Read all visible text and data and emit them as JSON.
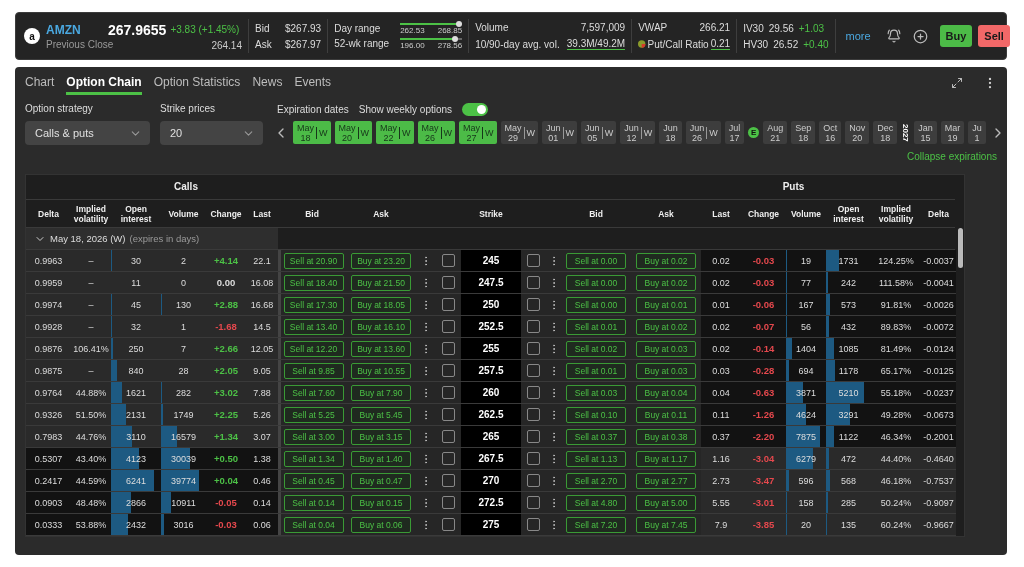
{
  "quote": {
    "logo": "a",
    "symbol": "AMZN",
    "subtitle": "Previous Close",
    "price": "267.9655",
    "change": "+3.83 (+1.45%)",
    "color": "#4cc146",
    "previous_close": "264.14",
    "bid_label": "Bid",
    "bid": "$267.93",
    "ask_label": "Ask",
    "ask": "$267.97",
    "ranges": [
      {
        "label": "Day range",
        "low": "262.53",
        "high": "268.85",
        "level": 0.95
      },
      {
        "label": "52-wk range",
        "low": "196.00",
        "high": "278.56",
        "level": 0.88
      }
    ],
    "volume_label": "Volume",
    "volume": "7,597,009",
    "avg_label": "10/90-day avg. vol.",
    "avg": "39.3M/49.2M",
    "vwap_label": "VWAP",
    "vwap": "266.21",
    "pc_label": "Put/Call Ratio",
    "pc": "0.21",
    "vols": [
      {
        "label": "IV30",
        "value": "29.56",
        "change": "+1.03",
        "color": "#4cc146"
      },
      {
        "label": "HV30",
        "value": "26.52",
        "change": "+0.40",
        "color": "#4cc146"
      }
    ],
    "more": "more",
    "buy": "Buy",
    "sell": "Sell"
  },
  "tabs": [
    {
      "label": "Chart",
      "selected": false
    },
    {
      "label": "Option Chain",
      "selected": true
    },
    {
      "label": "Option Statistics",
      "selected": false
    },
    {
      "label": "News",
      "selected": false
    },
    {
      "label": "Events",
      "selected": false
    }
  ],
  "controls": {
    "strategy": {
      "label": "Option strategy",
      "value": "Calls & puts"
    },
    "strikes": {
      "label": "Strike prices",
      "value": "20"
    },
    "expiration_label": "Expiration dates",
    "weekly": {
      "label": "Show weekly options",
      "on": true
    },
    "collapse": "Collapse expirations"
  },
  "expirations": [
    {
      "kind": "date",
      "month": "May",
      "day": "18",
      "tag": "W",
      "selected": true
    },
    {
      "kind": "date",
      "month": "May",
      "day": "20",
      "tag": "W",
      "selected": true
    },
    {
      "kind": "date",
      "month": "May",
      "day": "22",
      "tag": "W",
      "selected": true
    },
    {
      "kind": "date",
      "month": "May",
      "day": "26",
      "tag": "W",
      "selected": true
    },
    {
      "kind": "date",
      "month": "May",
      "day": "27",
      "tag": "W",
      "selected": true
    },
    {
      "kind": "date",
      "month": "May",
      "day": "29",
      "tag": "W",
      "selected": false
    },
    {
      "kind": "date",
      "month": "Jun",
      "day": "01",
      "tag": "W",
      "selected": false
    },
    {
      "kind": "date",
      "month": "Jun",
      "day": "05",
      "tag": "W",
      "selected": false
    },
    {
      "kind": "date",
      "month": "Jun",
      "day": "12",
      "tag": "W",
      "selected": false
    },
    {
      "kind": "date",
      "month": "Jun",
      "day": "18",
      "selected": false
    },
    {
      "kind": "date",
      "month": "Jun",
      "day": "26",
      "tag": "W",
      "selected": false
    },
    {
      "kind": "date",
      "month": "Jul",
      "day": "17",
      "selected": false
    },
    {
      "kind": "earnings",
      "label": "E"
    },
    {
      "kind": "date",
      "month": "Aug",
      "day": "21",
      "selected": false
    },
    {
      "kind": "date",
      "month": "Sep",
      "day": "18",
      "selected": false
    },
    {
      "kind": "date",
      "month": "Oct",
      "day": "16",
      "selected": false
    },
    {
      "kind": "date",
      "month": "Nov",
      "day": "20",
      "selected": false
    },
    {
      "kind": "date",
      "month": "Dec",
      "day": "18",
      "selected": false
    },
    {
      "kind": "year",
      "label": "2027"
    },
    {
      "kind": "date",
      "month": "Jan",
      "day": "15",
      "selected": false
    },
    {
      "kind": "date",
      "month": "Mar",
      "day": "19",
      "selected": false
    },
    {
      "kind": "date",
      "month": "Ju",
      "day": "1",
      "selected": false
    }
  ],
  "table": {
    "calls_title": "Calls",
    "puts_title": "Puts",
    "columns": [
      "Delta",
      "Implied volatility",
      "Open interest",
      "Volume",
      "Change",
      "Last",
      "Bid",
      "Ask",
      "Strike",
      "Bid",
      "Ask",
      "Last",
      "Change",
      "Volume",
      "Open interest",
      "Implied volatility",
      "Delta"
    ],
    "group": {
      "label": "May 18, 2026 (W)",
      "note": "(expires in days)",
      "expanded": true
    }
  },
  "rows": [
    {
      "strike": "245",
      "calls_itm": true,
      "call": {
        "delta": "0.9963",
        "iv": "–",
        "oi": "30",
        "volume": "2",
        "change": "+4.14",
        "color": "#4cc146",
        "last": "22.1",
        "bid": "Sell at 20.90",
        "ask": "Buy at 23.20",
        "checked": false
      },
      "put": {
        "bid": "Sell at 0.00",
        "ask": "Buy at 0.02",
        "last": "0.02",
        "change": "-0.03",
        "color": "#e5484d",
        "volume": "19",
        "oi": "1731",
        "iv": "124.25%",
        "delta": "-0.0037",
        "checked": false
      }
    },
    {
      "strike": "247.5",
      "calls_itm": true,
      "call": {
        "delta": "0.9959",
        "iv": "–",
        "oi": "11",
        "volume": "0",
        "change": "0.00",
        "color": "#dddddd",
        "last": "16.08",
        "bid": "Sell at 18.40",
        "ask": "Buy at 21.50",
        "checked": false
      },
      "put": {
        "bid": "Sell at 0.00",
        "ask": "Buy at 0.02",
        "last": "0.02",
        "change": "-0.03",
        "color": "#e5484d",
        "volume": "77",
        "oi": "242",
        "iv": "111.58%",
        "delta": "-0.0041",
        "checked": false
      }
    },
    {
      "strike": "250",
      "calls_itm": true,
      "call": {
        "delta": "0.9974",
        "iv": "–",
        "oi": "45",
        "volume": "130",
        "change": "+2.88",
        "color": "#4cc146",
        "last": "16.68",
        "bid": "Sell at 17.30",
        "ask": "Buy at 18.05",
        "checked": false
      },
      "put": {
        "bid": "Sell at 0.00",
        "ask": "Buy at 0.01",
        "last": "0.01",
        "change": "-0.06",
        "color": "#e5484d",
        "volume": "167",
        "oi": "573",
        "iv": "91.81%",
        "delta": "-0.0026",
        "checked": false
      }
    },
    {
      "strike": "252.5",
      "calls_itm": true,
      "call": {
        "delta": "0.9928",
        "iv": "–",
        "oi": "32",
        "volume": "1",
        "change": "-1.68",
        "color": "#e5484d",
        "last": "14.5",
        "bid": "Sell at 13.40",
        "ask": "Buy at 16.10",
        "checked": false
      },
      "put": {
        "bid": "Sell at 0.01",
        "ask": "Buy at 0.02",
        "last": "0.02",
        "change": "-0.07",
        "color": "#e5484d",
        "volume": "56",
        "oi": "432",
        "iv": "89.83%",
        "delta": "-0.0072",
        "checked": false
      }
    },
    {
      "strike": "255",
      "calls_itm": true,
      "call": {
        "delta": "0.9876",
        "iv": "106.41%",
        "oi": "250",
        "volume": "7",
        "change": "+2.66",
        "color": "#4cc146",
        "last": "12.05",
        "bid": "Sell at 12.20",
        "ask": "Buy at 13.60",
        "checked": false
      },
      "put": {
        "bid": "Sell at 0.02",
        "ask": "Buy at 0.03",
        "last": "0.02",
        "change": "-0.14",
        "color": "#e5484d",
        "volume": "1404",
        "oi": "1085",
        "iv": "81.49%",
        "delta": "-0.0124",
        "checked": false
      }
    },
    {
      "strike": "257.5",
      "calls_itm": true,
      "call": {
        "delta": "0.9875",
        "iv": "–",
        "oi": "840",
        "volume": "28",
        "change": "+2.05",
        "color": "#4cc146",
        "last": "9.05",
        "bid": "Sell at 9.85",
        "ask": "Buy at 10.55",
        "checked": false
      },
      "put": {
        "bid": "Sell at 0.01",
        "ask": "Buy at 0.03",
        "last": "0.03",
        "change": "-0.28",
        "color": "#e5484d",
        "volume": "694",
        "oi": "1178",
        "iv": "65.17%",
        "delta": "-0.0125",
        "checked": false
      }
    },
    {
      "strike": "260",
      "calls_itm": true,
      "call": {
        "delta": "0.9764",
        "iv": "44.88%",
        "oi": "1621",
        "volume": "282",
        "change": "+3.02",
        "color": "#4cc146",
        "last": "7.88",
        "bid": "Sell at 7.60",
        "ask": "Buy at 7.90",
        "checked": false
      },
      "put": {
        "bid": "Sell at 0.03",
        "ask": "Buy at 0.04",
        "last": "0.04",
        "change": "-0.63",
        "color": "#e5484d",
        "volume": "3871",
        "oi": "5210",
        "iv": "55.18%",
        "delta": "-0.0237",
        "checked": false
      }
    },
    {
      "strike": "262.5",
      "calls_itm": true,
      "call": {
        "delta": "0.9326",
        "iv": "51.50%",
        "oi": "2131",
        "volume": "1749",
        "change": "+2.25",
        "color": "#4cc146",
        "last": "5.26",
        "bid": "Sell at 5.25",
        "ask": "Buy at 5.45",
        "checked": false
      },
      "put": {
        "bid": "Sell at 0.10",
        "ask": "Buy at 0.11",
        "last": "0.11",
        "change": "-1.26",
        "color": "#e5484d",
        "volume": "4624",
        "oi": "3291",
        "iv": "49.28%",
        "delta": "-0.0673",
        "checked": false
      }
    },
    {
      "strike": "265",
      "calls_itm": true,
      "call": {
        "delta": "0.7983",
        "iv": "44.76%",
        "oi": "3110",
        "volume": "16579",
        "change": "+1.34",
        "color": "#4cc146",
        "last": "3.07",
        "bid": "Sell at 3.00",
        "ask": "Buy at 3.15",
        "checked": false
      },
      "put": {
        "bid": "Sell at 0.37",
        "ask": "Buy at 0.38",
        "last": "0.37",
        "change": "-2.20",
        "color": "#e5484d",
        "volume": "7875",
        "oi": "1122",
        "iv": "46.34%",
        "delta": "-0.2001",
        "checked": false
      }
    },
    {
      "strike": "267.5",
      "calls_itm": false,
      "call": {
        "delta": "0.5307",
        "iv": "43.40%",
        "oi": "4123",
        "volume": "30039",
        "change": "+0.50",
        "color": "#4cc146",
        "last": "1.38",
        "bid": "Sell at 1.34",
        "ask": "Buy at 1.40",
        "checked": false
      },
      "put": {
        "bid": "Sell at 1.13",
        "ask": "Buy at 1.17",
        "last": "1.16",
        "change": "-3.04",
        "color": "#e5484d",
        "volume": "6279",
        "oi": "472",
        "iv": "44.40%",
        "delta": "-0.4640",
        "checked": false
      }
    },
    {
      "strike": "270",
      "calls_itm": false,
      "call": {
        "delta": "0.2417",
        "iv": "44.59%",
        "oi": "6241",
        "volume": "39774",
        "change": "+0.04",
        "color": "#4cc146",
        "last": "0.46",
        "bid": "Sell at 0.45",
        "ask": "Buy at 0.47",
        "checked": false
      },
      "put": {
        "bid": "Sell at 2.70",
        "ask": "Buy at 2.77",
        "last": "2.73",
        "change": "-3.47",
        "color": "#e5484d",
        "volume": "596",
        "oi": "568",
        "iv": "46.18%",
        "delta": "-0.7537",
        "checked": false
      }
    },
    {
      "strike": "272.5",
      "calls_itm": false,
      "call": {
        "delta": "0.0903",
        "iv": "48.48%",
        "oi": "2866",
        "volume": "10911",
        "change": "-0.05",
        "color": "#e5484d",
        "last": "0.14",
        "bid": "Sell at 0.14",
        "ask": "Buy at 0.15",
        "checked": false
      },
      "put": {
        "bid": "Sell at 4.80",
        "ask": "Buy at 5.00",
        "last": "5.55",
        "change": "-3.01",
        "color": "#e5484d",
        "volume": "158",
        "oi": "285",
        "iv": "50.24%",
        "delta": "-0.9097",
        "checked": false
      }
    },
    {
      "strike": "275",
      "calls_itm": false,
      "call": {
        "delta": "0.0333",
        "iv": "53.88%",
        "oi": "2432",
        "volume": "3016",
        "change": "-0.03",
        "color": "#e5484d",
        "last": "0.06",
        "bid": "Sell at 0.04",
        "ask": "Buy at 0.06",
        "checked": false
      },
      "put": {
        "bid": "Sell at 7.20",
        "ask": "Buy at 7.45",
        "last": "7.9",
        "change": "-3.85",
        "color": "#e5484d",
        "volume": "20",
        "oi": "135",
        "iv": "60.24%",
        "delta": "-0.9667",
        "checked": false
      }
    }
  ]
}
